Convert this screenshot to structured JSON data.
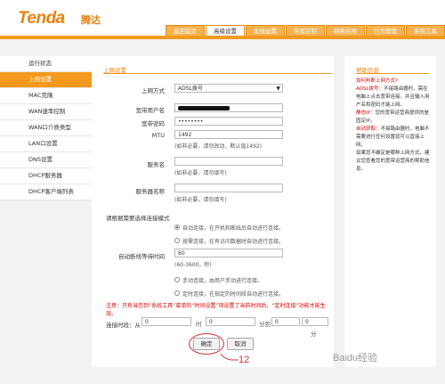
{
  "brand": {
    "logo": "Tenda",
    "logo_cn": "腾达"
  },
  "tabs": [
    "返回首页",
    "高级设置",
    "无线设置",
    "带宽控制",
    "特殊应用",
    "行为管理",
    "系统工具"
  ],
  "sidebar": [
    "运行状态",
    "上网设置",
    "MAC克隆",
    "WAN速率控制",
    "WAN口介质类型",
    "LAN口设置",
    "DNS设置",
    "DHCP服务器",
    "DHCP客户端列表"
  ],
  "form": {
    "section_title": "上网设置",
    "mode_label": "上网方式",
    "mode_value": "ADSL拨号",
    "user_label": "宽带用户名",
    "user_value": "",
    "pass_label": "宽带密码",
    "pass_value": "••••••••",
    "mtu_label": "MTU",
    "mtu_value": "1492",
    "mtu_hint": "(如非必要，请勿改动，默认值1492)",
    "service_label": "服务名",
    "service_hint": "(如非必要，请勿填写)",
    "server_label": "服务器名称",
    "server_hint": "(如非必要，请勿填写)",
    "choose_mode_label": "请根据需要选择连接模式",
    "opt_auto": "自动连接，在开机和断线后自动进行连接。",
    "opt_demand": "按需连接，在有访问数据时自动进行连接。",
    "idle_label": "自动断线等待时间",
    "idle_value": "60",
    "idle_hint": "(60-3600，秒)",
    "opt_manual": "手动连接，由用户手动进行连接。",
    "opt_timed": "定时连接，在指定的时间段自动进行连接。",
    "warning": "注意：只有当您到“系统工具”菜单的“时间设置”项设置了当前时间后，“定时连接”功能才能生效。",
    "time_label": "连接时段：从",
    "time_from_h": "0",
    "unit_hour": "时",
    "time_from_m": "0",
    "unit_min_to": "分到",
    "time_to_h": "0",
    "time_to_m": "0",
    "unit_min": "分",
    "ok_label": "确定",
    "cancel_label": "取消",
    "annotation": "12"
  },
  "help": {
    "title": "帮助信息",
    "q": "如何判断上网方式?",
    "adsl_key": "ADSL拨号：",
    "adsl_text": "不接路由器时，需在电脑上点击宽带连接，并且输入用户名和密码才能上网。",
    "static_key": "静态IP：",
    "static_text": "您的宽带运营商提供的是固定IP。",
    "dynamic_key": "自动获取：",
    "dynamic_text": "不接路由器时，电脑不需要进行任何设置就可以直接上网。",
    "tail": "如果您不确定是哪种上网方式，建议您查看您的宽带运营商的帮助信息。"
  },
  "watermark": "Baidu经验",
  "colors": {
    "accent": "#f39a1e",
    "warning": "#d60000"
  }
}
